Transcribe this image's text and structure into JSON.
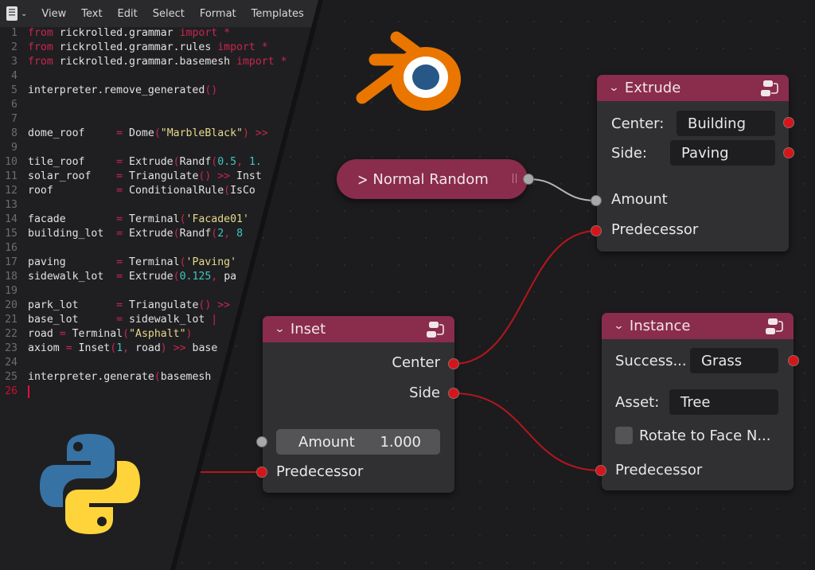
{
  "editor": {
    "menu": [
      "View",
      "Text",
      "Edit",
      "Select",
      "Format",
      "Templates"
    ],
    "editor_type_icon": "text-editor-icon",
    "lines": [
      {
        "n": "1",
        "tokens": [
          [
            "kw",
            "from"
          ],
          [
            "t",
            " rickrolled.grammar "
          ],
          [
            "kw",
            "import"
          ],
          [
            "op",
            " *"
          ]
        ]
      },
      {
        "n": "2",
        "tokens": [
          [
            "kw",
            "from"
          ],
          [
            "t",
            " rickrolled.grammar.rules "
          ],
          [
            "kw",
            "import"
          ],
          [
            "op",
            " *"
          ]
        ]
      },
      {
        "n": "3",
        "tokens": [
          [
            "kw",
            "from"
          ],
          [
            "t",
            " rickrolled.grammar.basemesh "
          ],
          [
            "kw",
            "import"
          ],
          [
            "op",
            " *"
          ]
        ]
      },
      {
        "n": "4",
        "tokens": []
      },
      {
        "n": "5",
        "tokens": [
          [
            "t",
            "interpreter.remove_generated"
          ],
          [
            "paren",
            "()"
          ]
        ]
      },
      {
        "n": "6",
        "tokens": []
      },
      {
        "n": "7",
        "tokens": []
      },
      {
        "n": "8",
        "tokens": [
          [
            "t",
            "dome_roof     "
          ],
          [
            "op",
            "="
          ],
          [
            "t",
            " Dome"
          ],
          [
            "paren",
            "("
          ],
          [
            "str",
            "\"MarbleBlack\""
          ],
          [
            "paren",
            ")"
          ],
          [
            "op",
            " >>"
          ]
        ]
      },
      {
        "n": "9",
        "tokens": []
      },
      {
        "n": "10",
        "tokens": [
          [
            "t",
            "tile_roof     "
          ],
          [
            "op",
            "="
          ],
          [
            "t",
            " Extrude"
          ],
          [
            "paren",
            "("
          ],
          [
            "t",
            "Randf"
          ],
          [
            "paren",
            "("
          ],
          [
            "num",
            "0.5"
          ],
          [
            "op",
            ","
          ],
          [
            "num",
            " 1."
          ]
        ]
      },
      {
        "n": "11",
        "tokens": [
          [
            "t",
            "solar_roof    "
          ],
          [
            "op",
            "="
          ],
          [
            "t",
            " Triangulate"
          ],
          [
            "paren",
            "()"
          ],
          [
            "op",
            " >>"
          ],
          [
            "t",
            " Inst"
          ]
        ]
      },
      {
        "n": "12",
        "tokens": [
          [
            "t",
            "roof          "
          ],
          [
            "op",
            "="
          ],
          [
            "t",
            " ConditionalRule"
          ],
          [
            "paren",
            "("
          ],
          [
            "t",
            "IsCo"
          ]
        ]
      },
      {
        "n": "13",
        "tokens": []
      },
      {
        "n": "14",
        "tokens": [
          [
            "t",
            "facade        "
          ],
          [
            "op",
            "="
          ],
          [
            "t",
            " Terminal"
          ],
          [
            "paren",
            "("
          ],
          [
            "str",
            "'Facade01'"
          ]
        ]
      },
      {
        "n": "15",
        "tokens": [
          [
            "t",
            "building_lot  "
          ],
          [
            "op",
            "="
          ],
          [
            "t",
            " Extrude"
          ],
          [
            "paren",
            "("
          ],
          [
            "t",
            "Randf"
          ],
          [
            "paren",
            "("
          ],
          [
            "num",
            "2"
          ],
          [
            "op",
            ","
          ],
          [
            "num",
            " 8"
          ]
        ]
      },
      {
        "n": "16",
        "tokens": []
      },
      {
        "n": "17",
        "tokens": [
          [
            "t",
            "paving        "
          ],
          [
            "op",
            "="
          ],
          [
            "t",
            " Terminal"
          ],
          [
            "paren",
            "("
          ],
          [
            "str",
            "'Paving'"
          ]
        ]
      },
      {
        "n": "18",
        "tokens": [
          [
            "t",
            "sidewalk_lot  "
          ],
          [
            "op",
            "="
          ],
          [
            "t",
            " Extrude"
          ],
          [
            "paren",
            "("
          ],
          [
            "num",
            "0.125"
          ],
          [
            "op",
            ","
          ],
          [
            "t",
            " pa"
          ]
        ]
      },
      {
        "n": "19",
        "tokens": []
      },
      {
        "n": "20",
        "tokens": [
          [
            "t",
            "park_lot      "
          ],
          [
            "op",
            "="
          ],
          [
            "t",
            " Triangulate"
          ],
          [
            "paren",
            "()"
          ],
          [
            "op",
            " >>"
          ]
        ]
      },
      {
        "n": "21",
        "tokens": [
          [
            "t",
            "base_lot      "
          ],
          [
            "op",
            "="
          ],
          [
            "t",
            " sidewalk_lot "
          ],
          [
            "op",
            "|"
          ]
        ]
      },
      {
        "n": "22",
        "tokens": [
          [
            "t",
            "road "
          ],
          [
            "op",
            "="
          ],
          [
            "t",
            " Terminal"
          ],
          [
            "paren",
            "("
          ],
          [
            "str",
            "\"Asphalt\""
          ],
          [
            "paren",
            ")"
          ]
        ]
      },
      {
        "n": "23",
        "tokens": [
          [
            "t",
            "axiom "
          ],
          [
            "op",
            "="
          ],
          [
            "t",
            " Inset"
          ],
          [
            "paren",
            "("
          ],
          [
            "num",
            "1"
          ],
          [
            "op",
            ","
          ],
          [
            "t",
            " road"
          ],
          [
            "paren",
            ")"
          ],
          [
            "op",
            " >>"
          ],
          [
            "t",
            " base"
          ]
        ]
      },
      {
        "n": "24",
        "tokens": []
      },
      {
        "n": "25",
        "tokens": [
          [
            "t",
            "interpreter.generate"
          ],
          [
            "paren",
            "("
          ],
          [
            "t",
            "basemesh"
          ]
        ]
      },
      {
        "n": "26",
        "tokens": [],
        "cursor": true
      }
    ]
  },
  "nodes": {
    "normal_random": {
      "title": "Normal Random",
      "collapsed": true
    },
    "extrude": {
      "title": "Extrude",
      "center_label": "Center:",
      "center_value": "Building",
      "side_label": "Side:",
      "side_value": "Paving",
      "amount_label": "Amount",
      "predecessor_label": "Predecessor"
    },
    "inset": {
      "title": "Inset",
      "center_label": "Center",
      "side_label": "Side",
      "amount_label": "Amount",
      "amount_value": "1.000",
      "predecessor_label": "Predecessor"
    },
    "instance": {
      "title": "Instance",
      "successor_label": "Success...",
      "successor_value": "Grass",
      "asset_label": "Asset:",
      "asset_value": "Tree",
      "rotate_label": "Rotate to Face N...",
      "rotate_checked": false,
      "predecessor_label": "Predecessor"
    }
  },
  "colors": {
    "node_header": "#8a2c4c",
    "socket_red": "#d4161c",
    "socket_grey": "#a8a8ab",
    "wire_red": "#b5161c",
    "wire_grey": "#b4b4b4",
    "blender_orange": "#ea7600",
    "blender_blue": "#265787",
    "python_blue": "#3772a4",
    "python_yellow": "#ffd43b"
  }
}
